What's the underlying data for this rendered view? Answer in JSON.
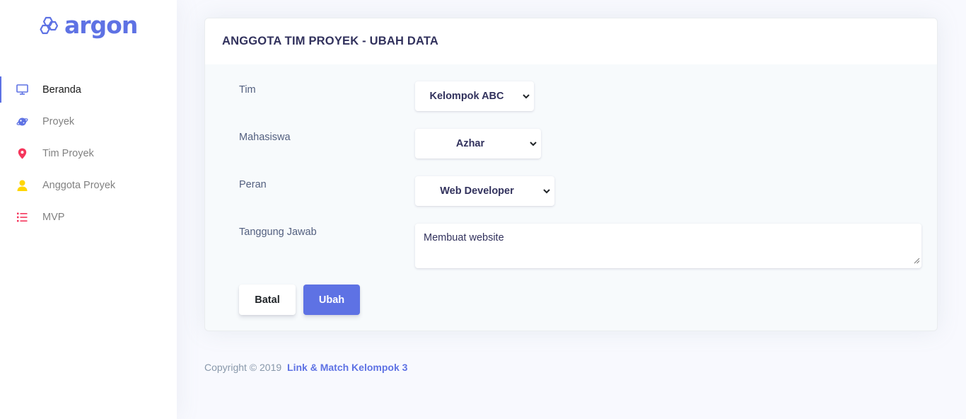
{
  "brand": {
    "name": "argon",
    "logo_icon": "hexagon-logo-icon",
    "color": "#5e72e4"
  },
  "sidebar": {
    "items": [
      {
        "label": "Beranda",
        "icon": "monitor-icon",
        "color": "#5e72e4",
        "active": true
      },
      {
        "label": "Proyek",
        "icon": "planet-icon",
        "color": "#5e72e4",
        "active": false
      },
      {
        "label": "Tim Proyek",
        "icon": "location-pin-icon",
        "color": "#f5365c",
        "active": false
      },
      {
        "label": "Anggota Proyek",
        "icon": "user-icon",
        "color": "#ffd600",
        "active": false
      },
      {
        "label": "MVP",
        "icon": "list-icon",
        "color": "#f5365c",
        "active": false
      }
    ]
  },
  "card": {
    "title": "ANGGOTA TIM PROYEK - UBAH DATA",
    "fields": {
      "tim": {
        "label": "Tim",
        "value": "Kelompok ABC"
      },
      "mahasiswa": {
        "label": "Mahasiswa",
        "value": "Azhar"
      },
      "peran": {
        "label": "Peran",
        "value": "Web Developer"
      },
      "tanggung_jawab": {
        "label": "Tanggung Jawab",
        "value": "Membuat website"
      }
    },
    "buttons": {
      "cancel": "Batal",
      "submit": "Ubah"
    }
  },
  "footer": {
    "copyright": "Copyright © 2019",
    "link": "Link & Match Kelompok 3"
  },
  "colors": {
    "primary": "#5e72e4",
    "background": "#f8f9fe"
  }
}
